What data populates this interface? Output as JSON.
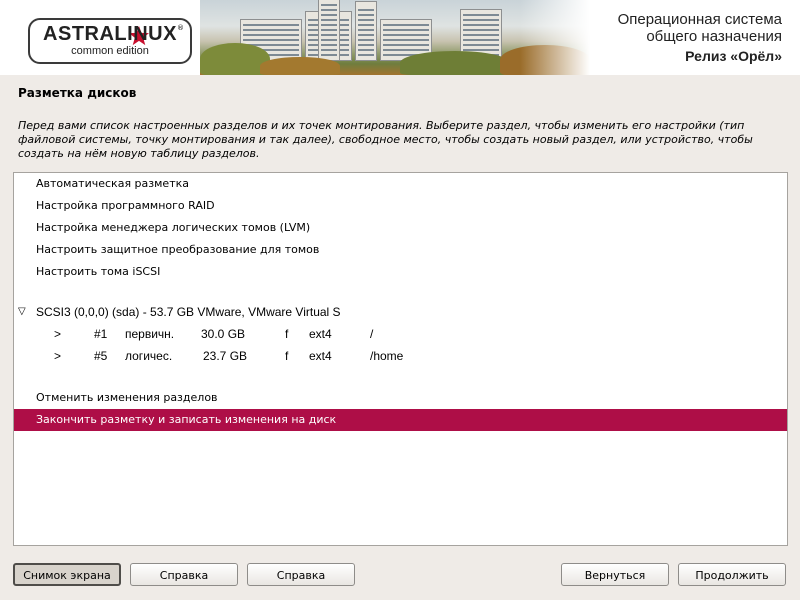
{
  "header": {
    "logo_name": "ASTRALINUX",
    "logo_sub": "common edition",
    "logo_reg": "®",
    "title_line1": "Операционная система",
    "title_line2": "общего назначения",
    "release": "Релиз «Орёл»",
    "star_color": "#c8102e"
  },
  "page": {
    "title": "Разметка дисков",
    "description": "Перед вами список настроенных разделов и их точек монтирования. Выберите раздел, чтобы изменить его настройки (тип файловой системы, точку монтирования и так далее), свободное место, чтобы создать новый раздел, или устройство, чтобы создать на нём новую таблицу разделов."
  },
  "list": {
    "items": [
      "Автоматическая разметка",
      "Настройка программного RAID",
      "Настройка менеджера логических томов (LVM)",
      "Настроить защитное преобразование для томов",
      "Настроить тома iSCSI"
    ],
    "device": "SCSI3 (0,0,0) (sda) - 53.7 GB VMware, VMware Virtual S",
    "partitions": [
      {
        "arrow": ">",
        "num": "#1",
        "type": "первичн.",
        "size": "30.0 GB",
        "flag": "f",
        "fs": "ext4",
        "mount": "/"
      },
      {
        "arrow": ">",
        "num": "#5",
        "type": "логичес.",
        "size": "23.7 GB",
        "flag": "f",
        "fs": "ext4",
        "mount": "/home"
      }
    ],
    "undo": "Отменить изменения разделов",
    "finish": "Закончить разметку и записать изменения на диск",
    "selected_color": "#ae0e47"
  },
  "buttons": {
    "screenshot": "Снимок экрана",
    "help1": "Справка",
    "help2": "Справка",
    "back": "Вернуться",
    "continue": "Продолжить"
  }
}
